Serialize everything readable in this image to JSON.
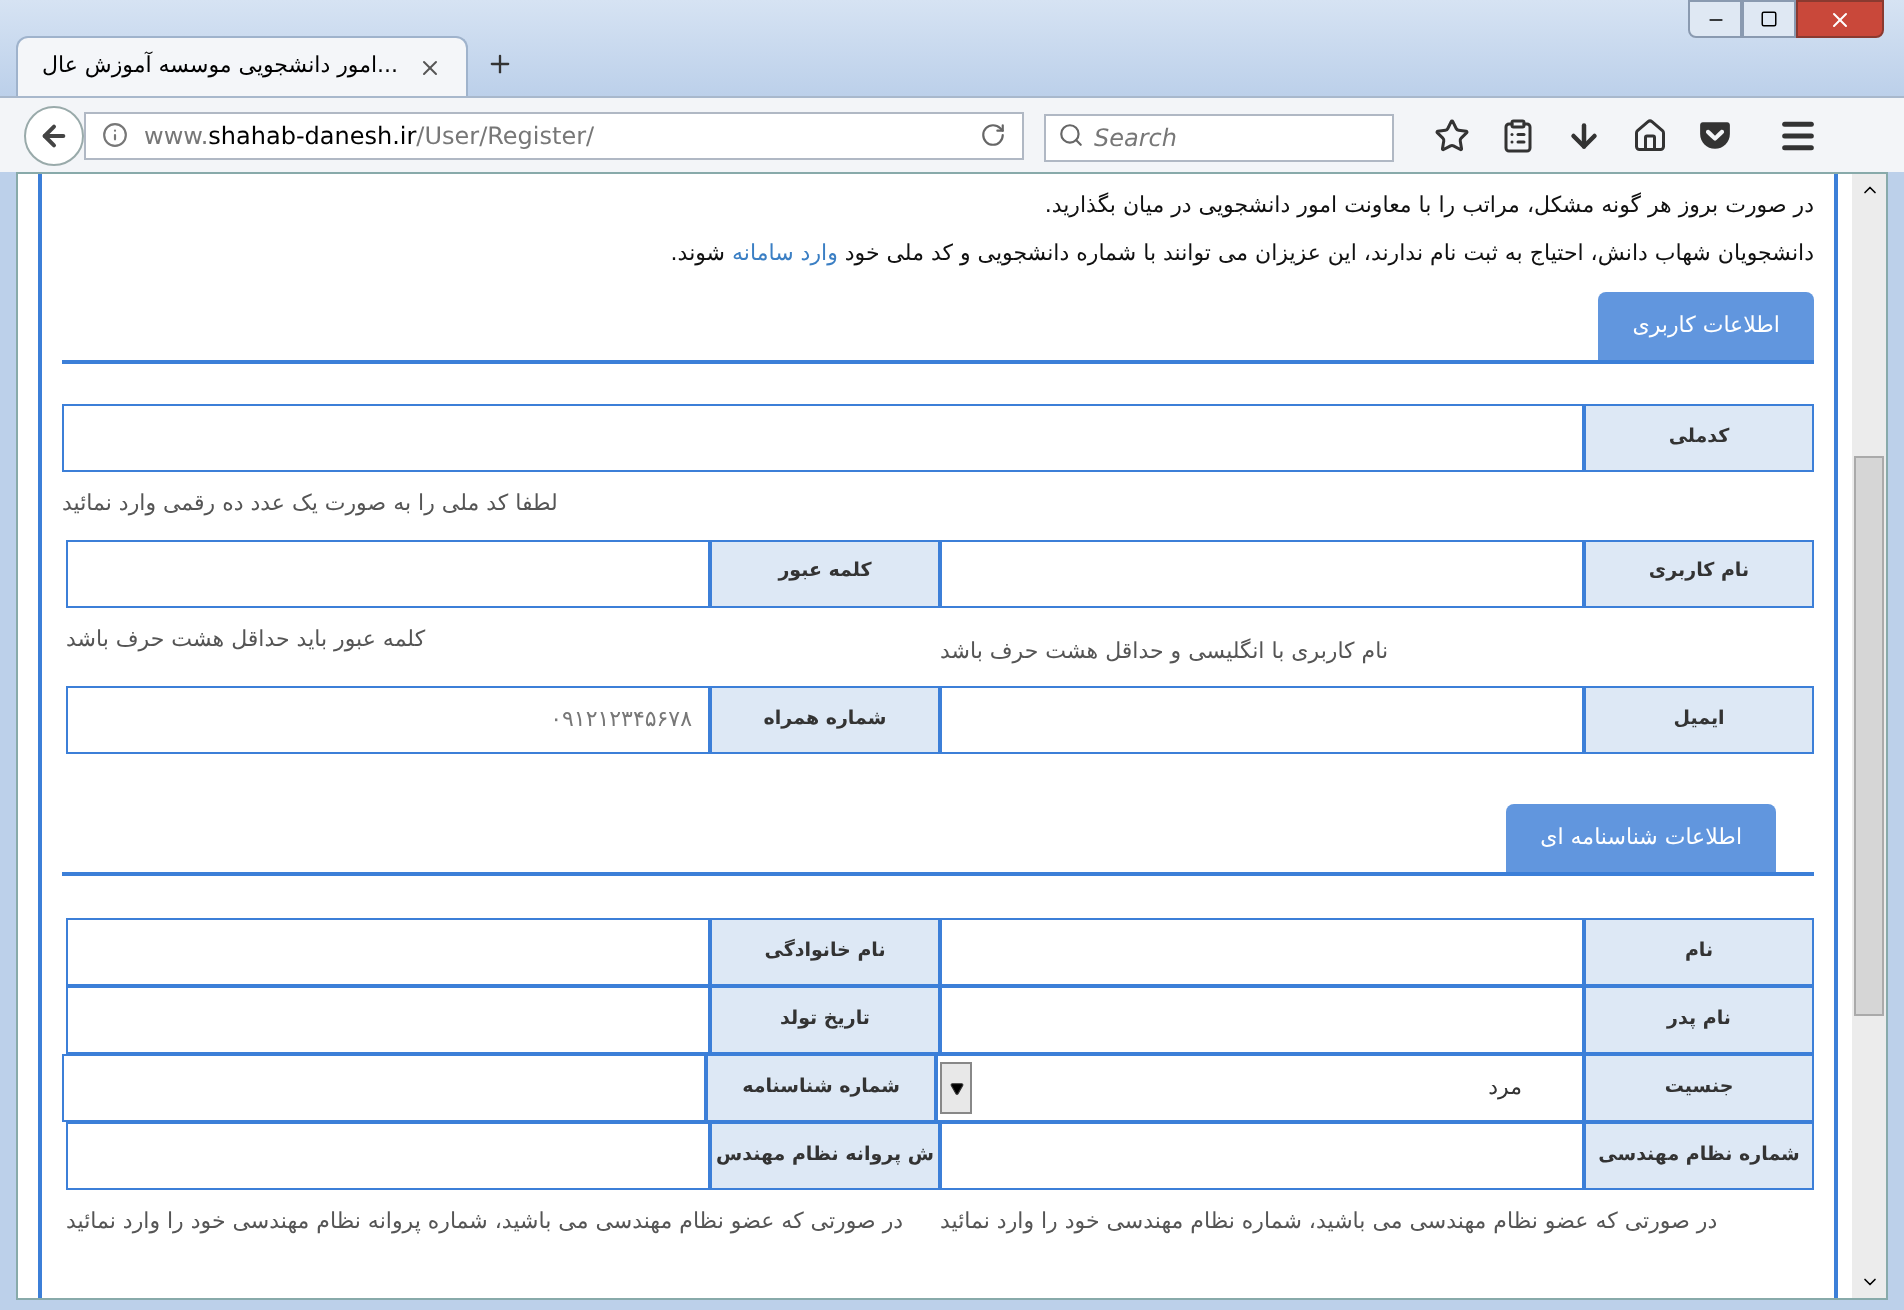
{
  "browser": {
    "tab_title": "...امور دانشجویی موسسه آموزش عال",
    "url": {
      "prefix": "www.",
      "host": "shahab-danesh.ir",
      "path": "/User/Register/"
    },
    "search": {
      "placeholder": "Search"
    }
  },
  "intro": [
    {
      "text": "در صورت بروز هر گونه مشکل، مراتب را با معاونت امور دانشجویی در میان بگذارید."
    },
    {
      "text": "دانشجویان شهاب دانش، احتیاج به ثبت نام ندارند، این عزیزان می توانند با شماره دانشجویی و کد ملی خود",
      "link": "وارد سامانه",
      "after": "شوند."
    }
  ],
  "sections": [
    {
      "title": "اطلاعات کاربری",
      "kind": "spaced",
      "rows": [
        {
          "fields": [
            {
              "label": "کدملی",
              "kind": "text"
            }
          ],
          "hints": [
            "لطفا کد ملی را به صورت یک عدد ده رقمی وارد نمائید"
          ]
        },
        {
          "fields": [
            {
              "label": "نام کاربری",
              "kind": "text"
            },
            {
              "label": "کلمه عبور",
              "kind": "text"
            }
          ],
          "hints": [
            "نام کاربری با انگلیسی و حداقل هشت حرف باشد",
            "کلمه عبور باید حداقل هشت حرف باشد"
          ]
        },
        {
          "fields": [
            {
              "label": "ایمیل",
              "kind": "text"
            },
            {
              "label": "شماره همراه",
              "kind": "text",
              "placeholder": "۰۹۱۲۱۲۳۴۵۶۷۸"
            }
          ]
        }
      ]
    },
    {
      "title": "اطلاعات شناسنامه ای",
      "kind": "table",
      "rows": [
        {
          "fields": [
            {
              "label": "نام",
              "kind": "text"
            },
            {
              "label": "نام خانوادگی",
              "kind": "text"
            }
          ]
        },
        {
          "fields": [
            {
              "label": "نام پدر",
              "kind": "text"
            },
            {
              "label": "تاریخ تولد",
              "kind": "text"
            }
          ]
        },
        {
          "fields": [
            {
              "label": "جنسیت",
              "kind": "select",
              "value": "مرد"
            },
            {
              "label": "شماره شناسنامه",
              "kind": "text"
            }
          ]
        },
        {
          "fields": [
            {
              "label": "شماره نظام مهندسی",
              "kind": "text"
            },
            {
              "label": "ش پروانه نظام مهندس",
              "kind": "text"
            }
          ],
          "hints": [
            "در صورتی که عضو نظام مهندسی می باشید، شماره نظام مهندسی خود را وارد نمائید",
            "در صورتی که عضو نظام مهندسی می باشید، شماره پروانه نظام مهندسی خود را وارد نمائید"
          ]
        }
      ]
    }
  ]
}
